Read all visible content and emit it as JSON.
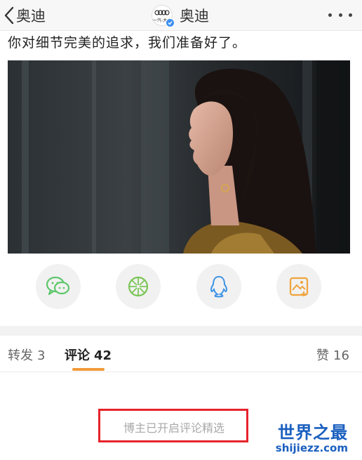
{
  "header": {
    "back_label": "奥迪",
    "title": "奥迪",
    "avatar_text": "一汽-大众"
  },
  "post": {
    "text": "你对细节完美的追求，我们准备好了。"
  },
  "share": {
    "items": [
      {
        "icon": "wechat-icon",
        "color": "#5dc76b"
      },
      {
        "icon": "moments-icon",
        "color": "#7bc657"
      },
      {
        "icon": "qq-icon",
        "color": "#3f94e6"
      },
      {
        "icon": "save-image-icon",
        "color": "#f0a43c"
      }
    ]
  },
  "tabs": {
    "repost": {
      "label": "转发",
      "count": "3"
    },
    "comments": {
      "label": "评论",
      "count": "42"
    },
    "likes": {
      "label": "赞",
      "count": "16"
    }
  },
  "notice": "博主已开启评论精选",
  "watermark": {
    "title": "世界之最",
    "url": "shijiezz.com"
  },
  "colors": {
    "tab_underline": "#f19a3a",
    "highlight_box": "#e6232b",
    "watermark": "#1a5fbf"
  }
}
